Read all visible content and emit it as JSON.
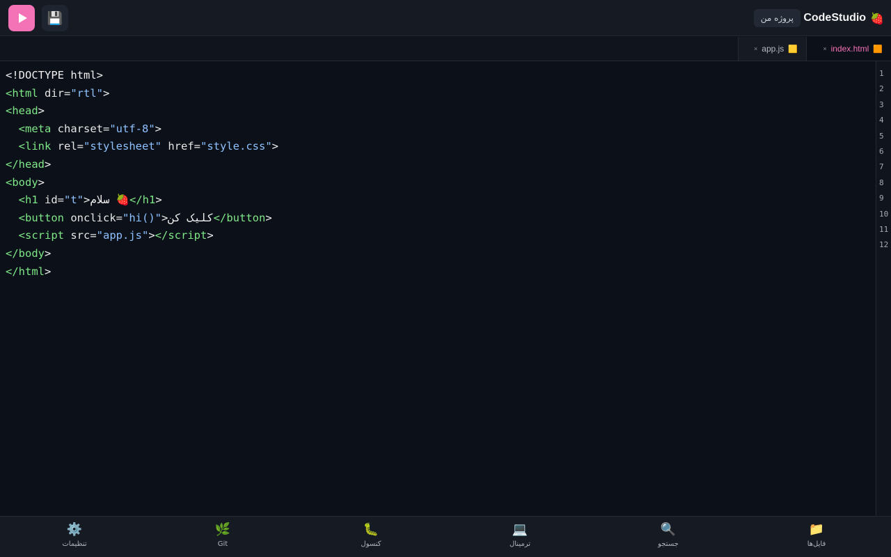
{
  "header": {
    "brand_name": "CodeStudio",
    "brand_icon": "🍓",
    "project_label": "پروژه من",
    "run_icon": "play-icon",
    "save_icon": "💾"
  },
  "tabs": [
    {
      "label": "index.html",
      "icon": "🟧",
      "close": "×",
      "active": true
    },
    {
      "label": "app.js",
      "icon": "🟨",
      "close": "×",
      "active": false
    }
  ],
  "code_lines": [
    [
      {
        "c": "tx",
        "t": "<!DOCTYPE html>"
      }
    ],
    [
      {
        "c": "tg",
        "t": "<html"
      },
      {
        "c": "at",
        "t": " dir="
      },
      {
        "c": "st",
        "t": "\"rtl\""
      },
      {
        "c": "tx",
        "t": ">"
      }
    ],
    [
      {
        "c": "tg",
        "t": "<head"
      },
      {
        "c": "tx",
        "t": ">"
      }
    ],
    [
      {
        "c": "tx",
        "t": "  "
      },
      {
        "c": "tg",
        "t": "<meta"
      },
      {
        "c": "at",
        "t": " charset="
      },
      {
        "c": "st",
        "t": "\"utf-8\""
      },
      {
        "c": "tx",
        "t": ">"
      }
    ],
    [
      {
        "c": "tx",
        "t": "  "
      },
      {
        "c": "tg",
        "t": "<link"
      },
      {
        "c": "at",
        "t": " rel="
      },
      {
        "c": "st",
        "t": "\"stylesheet\""
      },
      {
        "c": "at",
        "t": " href="
      },
      {
        "c": "st",
        "t": "\"style.css\""
      },
      {
        "c": "tx",
        "t": ">"
      }
    ],
    [
      {
        "c": "tg",
        "t": "</head"
      },
      {
        "c": "tx",
        "t": ">"
      }
    ],
    [
      {
        "c": "tg",
        "t": "<body"
      },
      {
        "c": "tx",
        "t": ">"
      }
    ],
    [
      {
        "c": "tx",
        "t": "  "
      },
      {
        "c": "tg",
        "t": "<h1"
      },
      {
        "c": "at",
        "t": " id="
      },
      {
        "c": "st",
        "t": "\"t\""
      },
      {
        "c": "tx",
        "t": ">سلام 🍓"
      },
      {
        "c": "tg",
        "t": "</h1"
      },
      {
        "c": "tx",
        "t": ">"
      }
    ],
    [
      {
        "c": "tx",
        "t": "  "
      },
      {
        "c": "tg",
        "t": "<button"
      },
      {
        "c": "at",
        "t": " onclick="
      },
      {
        "c": "st",
        "t": "\"hi()\""
      },
      {
        "c": "tx",
        "t": ">کلیک کن"
      },
      {
        "c": "tg",
        "t": "</button"
      },
      {
        "c": "tx",
        "t": ">"
      }
    ],
    [
      {
        "c": "tx",
        "t": "  "
      },
      {
        "c": "tg",
        "t": "<script"
      },
      {
        "c": "at",
        "t": " src="
      },
      {
        "c": "st",
        "t": "\"app.js\""
      },
      {
        "c": "tx",
        "t": ">"
      },
      {
        "c": "tg",
        "t": "</script"
      },
      {
        "c": "tx",
        "t": ">"
      }
    ],
    [
      {
        "c": "tg",
        "t": "</body"
      },
      {
        "c": "tx",
        "t": ">"
      }
    ],
    [
      {
        "c": "tg",
        "t": "</html"
      },
      {
        "c": "tx",
        "t": ">"
      }
    ]
  ],
  "line_numbers": [
    "1",
    "2",
    "3",
    "4",
    "5",
    "6",
    "7",
    "8",
    "9",
    "10",
    "11",
    "12"
  ],
  "bottom_nav": [
    {
      "name": "files",
      "icon": "📁",
      "label": "فایل‌ها"
    },
    {
      "name": "search",
      "icon": "🔍",
      "label": "جستجو"
    },
    {
      "name": "terminal",
      "icon": "💻",
      "label": "ترمینال"
    },
    {
      "name": "console",
      "icon": "🐛",
      "label": "کنسول"
    },
    {
      "name": "git",
      "icon": "🌿",
      "label": "Git"
    },
    {
      "name": "settings",
      "icon": "⚙️",
      "label": "تنظیمات"
    }
  ]
}
